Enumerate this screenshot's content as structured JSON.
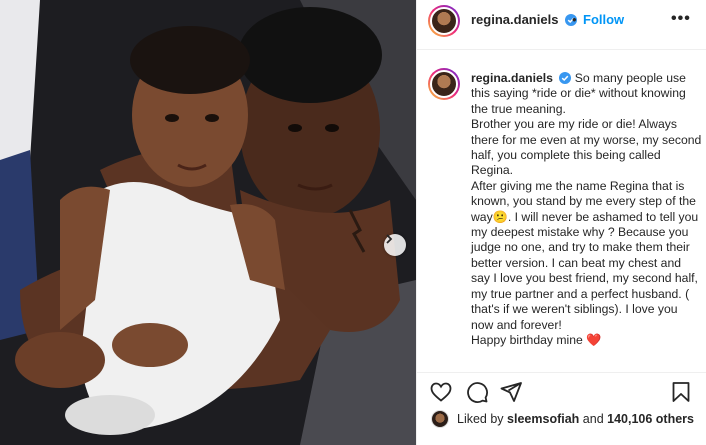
{
  "post": {
    "username": "regina.daniels",
    "follow_label": "Follow",
    "separator": "•",
    "more_label": "•••",
    "caption": {
      "username": "regina.daniels",
      "lines": [
        "So many people use this saying *ride or die* without knowing the true meaning.",
        "Brother you are my ride or die! Always there for me even at my worse, my second half, you complete this being called Regina.",
        "After giving me the name Regina that is known, you stand by me every step of the way😕. I will never be ashamed to tell you my deepest mistake why ? Because you judge no one, and try to make them their better version. I can beat my chest and say I love you best friend, my second half, my true partner and a perfect husband. ( that's if we weren't siblings). I love you now and forever!",
        "Happy birthday mine ❤️"
      ]
    },
    "likes": {
      "prefix": "Liked by",
      "user": "sleemsofiah",
      "conjunction": "and",
      "count": "140,106 others"
    },
    "icons": {
      "verified": "verified-badge-icon",
      "like": "heart-icon",
      "comment": "comment-icon",
      "share": "share-icon",
      "save": "bookmark-icon",
      "next": "chevron-right-icon"
    },
    "colors": {
      "follow": "#0095f6",
      "verified": "#3897f0",
      "heart": "#d01c2f"
    }
  }
}
